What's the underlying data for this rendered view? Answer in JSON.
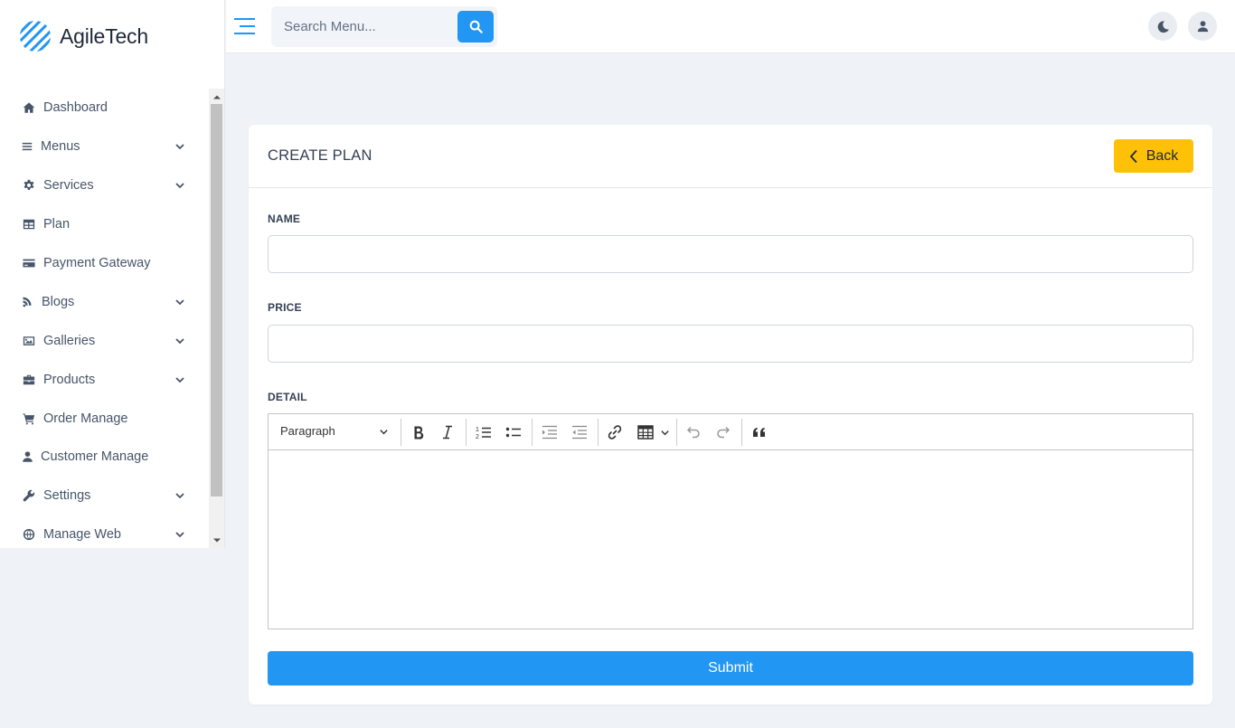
{
  "brand": {
    "name": "AgileTech",
    "logo_icon": "striped-globe-logo",
    "logo_color": "#2196f3"
  },
  "sidebar": {
    "items": [
      {
        "label": "Dashboard",
        "icon": "home-icon",
        "has_submenu": false
      },
      {
        "label": "Menus",
        "icon": "bars-icon",
        "has_submenu": true
      },
      {
        "label": "Services",
        "icon": "gear-icon",
        "has_submenu": true
      },
      {
        "label": "Plan",
        "icon": "table-icon",
        "has_submenu": false
      },
      {
        "label": "Payment Gateway",
        "icon": "credit-card-icon",
        "has_submenu": false
      },
      {
        "label": "Blogs",
        "icon": "blog-icon",
        "has_submenu": true
      },
      {
        "label": "Galleries",
        "icon": "image-icon",
        "has_submenu": true
      },
      {
        "label": "Products",
        "icon": "briefcase-icon",
        "has_submenu": true
      },
      {
        "label": "Order Manage",
        "icon": "cart-icon",
        "has_submenu": false
      },
      {
        "label": "Customer Manage",
        "icon": "user-icon",
        "has_submenu": false
      },
      {
        "label": "Settings",
        "icon": "wrench-icon",
        "has_submenu": true
      },
      {
        "label": "Manage Web",
        "icon": "globe-icon",
        "has_submenu": true
      }
    ]
  },
  "topbar": {
    "search_placeholder": "Search Menu...",
    "accent": "#2196f3"
  },
  "card": {
    "title": "CREATE PLAN",
    "back_label": "Back",
    "back_color": "#ffc107"
  },
  "form": {
    "name_label": "NAME",
    "name_value": "",
    "price_label": "PRICE",
    "price_value": "",
    "detail_label": "DETAIL",
    "detail_value": "",
    "heading_select": "Paragraph",
    "submit_label": "Submit",
    "submit_color": "#2196f3"
  }
}
